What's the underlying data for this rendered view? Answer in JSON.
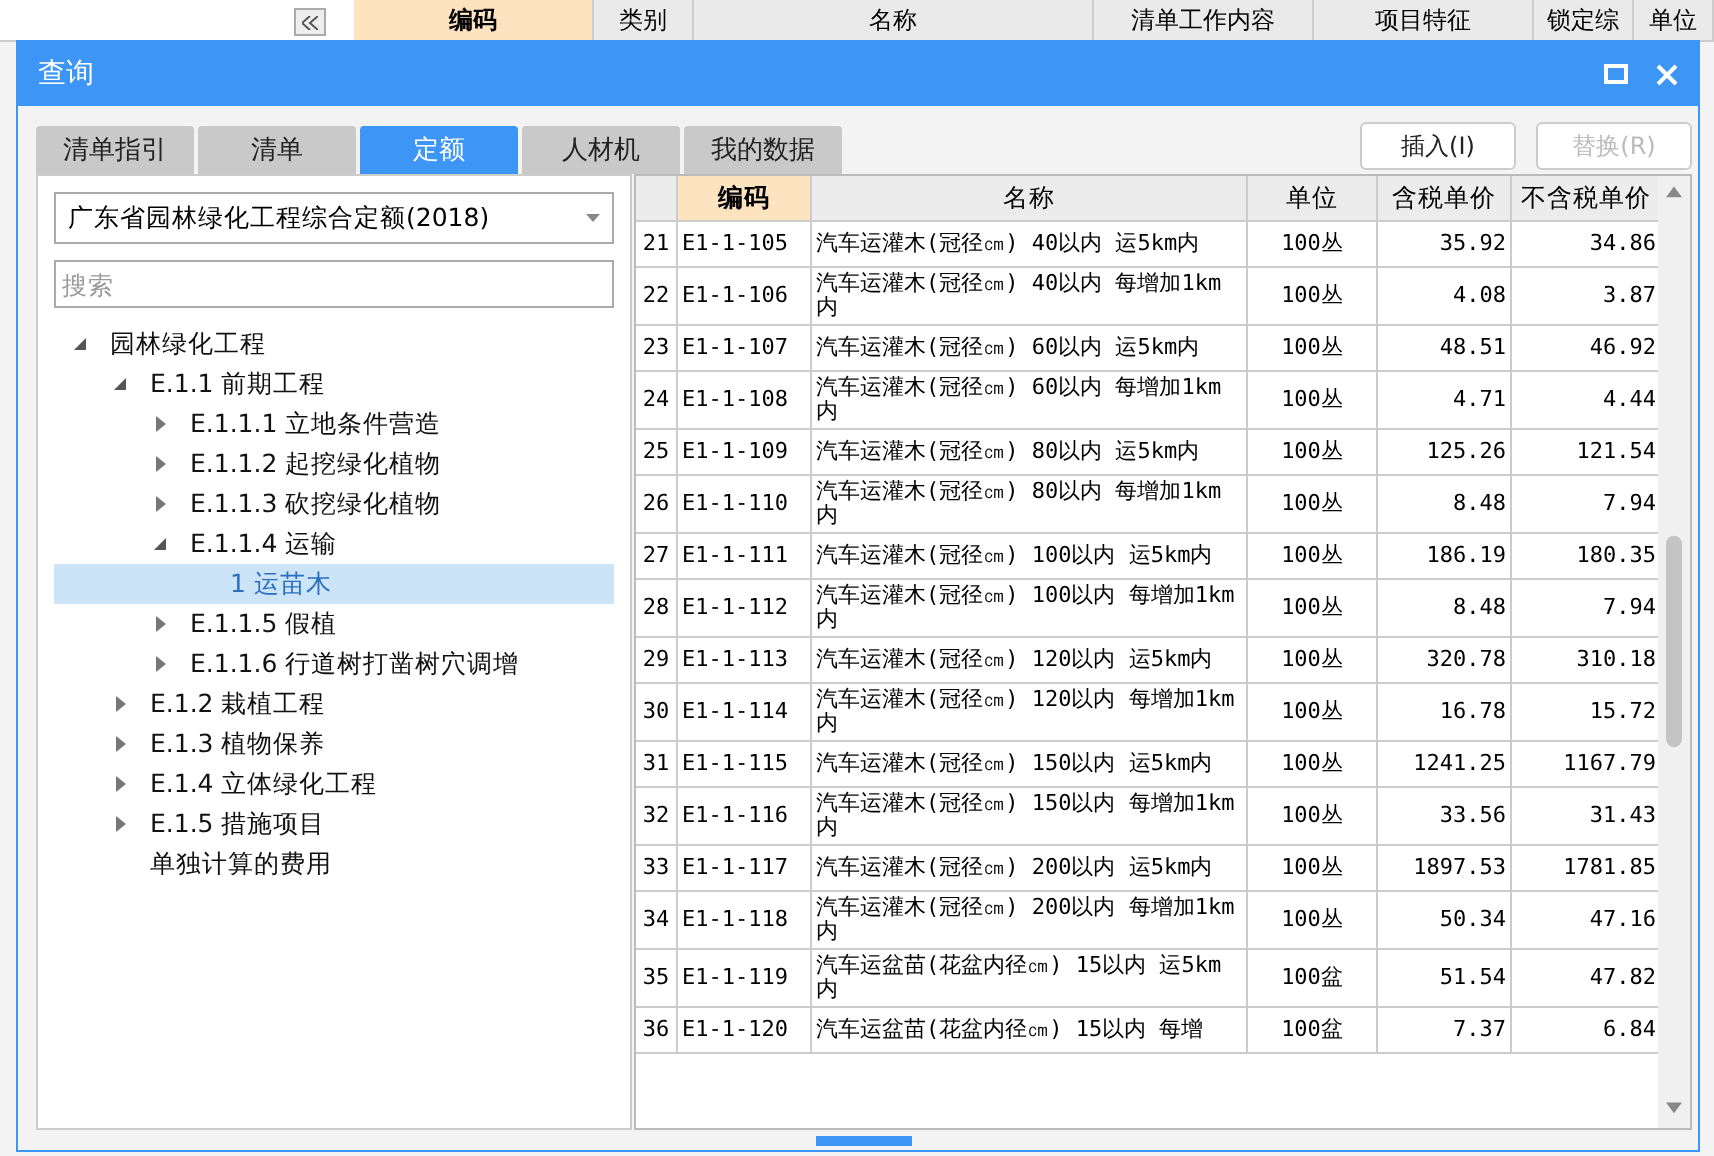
{
  "background": {
    "columns": [
      {
        "label": "编码",
        "selected": true
      },
      {
        "label": "类别",
        "selected": false
      },
      {
        "label": "名称",
        "selected": false
      },
      {
        "label": "清单工作内容",
        "selected": false
      },
      {
        "label": "项目特征",
        "selected": false
      },
      {
        "label": "锁定综",
        "selected": false
      },
      {
        "label": "单位",
        "selected": false
      }
    ]
  },
  "dialog": {
    "title": "查询",
    "tabs": [
      {
        "label": "清单指引",
        "selected": false
      },
      {
        "label": "清单",
        "selected": false
      },
      {
        "label": "定额",
        "selected": true
      },
      {
        "label": "人材机",
        "selected": false
      },
      {
        "label": "我的数据",
        "selected": false
      }
    ],
    "buttons": [
      {
        "label": "插入(I)",
        "disabled": false
      },
      {
        "label": "替换(R)",
        "disabled": true
      }
    ],
    "library": {
      "value": "广东省园林绿化工程综合定额(2018)"
    },
    "search": {
      "placeholder": "搜索"
    },
    "tree": [
      {
        "label": "园林绿化工程",
        "expanded": true,
        "selected": false,
        "children": [
          {
            "label": "E.1.1 前期工程",
            "expanded": true,
            "selected": false,
            "children": [
              {
                "label": "E.1.1.1 立地条件营造",
                "expanded": false,
                "selected": false
              },
              {
                "label": "E.1.1.2 起挖绿化植物",
                "expanded": false,
                "selected": false
              },
              {
                "label": "E.1.1.3 砍挖绿化植物",
                "expanded": false,
                "selected": false
              },
              {
                "label": "E.1.1.4 运输",
                "expanded": true,
                "selected": false,
                "children": [
                  {
                    "label": "1 运苗木",
                    "selected": true
                  }
                ]
              },
              {
                "label": "E.1.1.5 假植",
                "expanded": false,
                "selected": false
              },
              {
                "label": "E.1.1.6 行道树打凿树穴调增",
                "expanded": false,
                "selected": false
              }
            ]
          },
          {
            "label": "E.1.2 栽植工程",
            "expanded": false,
            "selected": false
          },
          {
            "label": "E.1.3 植物保养",
            "expanded": false,
            "selected": false
          },
          {
            "label": "E.1.4 立体绿化工程",
            "expanded": false,
            "selected": false
          },
          {
            "label": "E.1.5 措施项目",
            "expanded": false,
            "selected": false
          },
          {
            "label": "单独计算的费用",
            "selected": false
          }
        ]
      }
    ],
    "table": {
      "columns": [
        {
          "label": "编码",
          "selected": true
        },
        {
          "label": "名称",
          "selected": false
        },
        {
          "label": "单位",
          "selected": false
        },
        {
          "label": "含税单价",
          "selected": false
        },
        {
          "label": "不含税单价",
          "selected": false
        }
      ],
      "rows": [
        {
          "index": "21",
          "code": "E1-1-105",
          "name": "汽车运灌木(冠径㎝) 40以内 运5km内",
          "unit": "100丛",
          "price_tax": "35.92",
          "price_net": "34.86"
        },
        {
          "index": "22",
          "code": "E1-1-106",
          "name": "汽车运灌木(冠径㎝) 40以内 每增加1km内",
          "unit": "100丛",
          "price_tax": "4.08",
          "price_net": "3.87"
        },
        {
          "index": "23",
          "code": "E1-1-107",
          "name": "汽车运灌木(冠径㎝) 60以内 运5km内",
          "unit": "100丛",
          "price_tax": "48.51",
          "price_net": "46.92"
        },
        {
          "index": "24",
          "code": "E1-1-108",
          "name": "汽车运灌木(冠径㎝) 60以内 每增加1km内",
          "unit": "100丛",
          "price_tax": "4.71",
          "price_net": "4.44"
        },
        {
          "index": "25",
          "code": "E1-1-109",
          "name": "汽车运灌木(冠径㎝) 80以内 运5km内",
          "unit": "100丛",
          "price_tax": "125.26",
          "price_net": "121.54"
        },
        {
          "index": "26",
          "code": "E1-1-110",
          "name": "汽车运灌木(冠径㎝) 80以内 每增加1km内",
          "unit": "100丛",
          "price_tax": "8.48",
          "price_net": "7.94"
        },
        {
          "index": "27",
          "code": "E1-1-111",
          "name": "汽车运灌木(冠径㎝) 100以内 运5km内",
          "unit": "100丛",
          "price_tax": "186.19",
          "price_net": "180.35"
        },
        {
          "index": "28",
          "code": "E1-1-112",
          "name": "汽车运灌木(冠径㎝) 100以内 每增加1km内",
          "unit": "100丛",
          "price_tax": "8.48",
          "price_net": "7.94"
        },
        {
          "index": "29",
          "code": "E1-1-113",
          "name": "汽车运灌木(冠径㎝) 120以内 运5km内",
          "unit": "100丛",
          "price_tax": "320.78",
          "price_net": "310.18"
        },
        {
          "index": "30",
          "code": "E1-1-114",
          "name": "汽车运灌木(冠径㎝) 120以内 每增加1km内",
          "unit": "100丛",
          "price_tax": "16.78",
          "price_net": "15.72"
        },
        {
          "index": "31",
          "code": "E1-1-115",
          "name": "汽车运灌木(冠径㎝) 150以内 运5km内",
          "unit": "100丛",
          "price_tax": "1241.25",
          "price_net": "1167.79"
        },
        {
          "index": "32",
          "code": "E1-1-116",
          "name": "汽车运灌木(冠径㎝) 150以内 每增加1km内",
          "unit": "100丛",
          "price_tax": "33.56",
          "price_net": "31.43"
        },
        {
          "index": "33",
          "code": "E1-1-117",
          "name": "汽车运灌木(冠径㎝) 200以内 运5km内",
          "unit": "100丛",
          "price_tax": "1897.53",
          "price_net": "1781.85"
        },
        {
          "index": "34",
          "code": "E1-1-118",
          "name": "汽车运灌木(冠径㎝) 200以内 每增加1km内",
          "unit": "100丛",
          "price_tax": "50.34",
          "price_net": "47.16"
        },
        {
          "index": "35",
          "code": "E1-1-119",
          "name": "汽车运盆苗(花盆内径㎝) 15以内 运5km内",
          "unit": "100盆",
          "price_tax": "51.54",
          "price_net": "47.82"
        },
        {
          "index": "36",
          "code": "E1-1-120",
          "name": "汽车运盆苗(花盆内径㎝) 15以内 每增",
          "unit": "100盆",
          "price_tax": "7.37",
          "price_net": "6.84"
        }
      ]
    }
  }
}
